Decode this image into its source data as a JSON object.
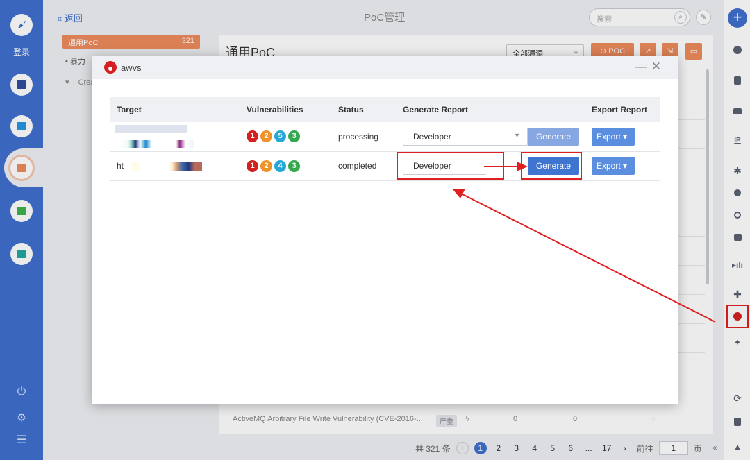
{
  "sidebar": {
    "login_label": "登录",
    "icon_colors": [
      "#2f4e9e",
      "#2596e0",
      "#ee8a5c",
      "#3fb34f",
      "#1fa8a0"
    ]
  },
  "header": {
    "back_label": "« 返回",
    "title": "PoC管理",
    "search_placeholder": "搜索"
  },
  "poc_list": {
    "active_item": {
      "label": "通用PoC",
      "count": "321"
    },
    "second_item_label": "暴力",
    "third_item_label": "Crea"
  },
  "main": {
    "title": "通用PoC",
    "filter_value": "全部漏洞",
    "poc_button_label": "POC",
    "last_row": {
      "name": "ActiveMQ Arbitrary File Write Vulnerability (CVE-2016-...",
      "severity": "严重",
      "count_a": "0",
      "count_b": "0"
    }
  },
  "pagination": {
    "total_label": "共 321 条",
    "pages": [
      "1",
      "2",
      "3",
      "4",
      "5",
      "6",
      "...",
      "17"
    ],
    "current_page": "1",
    "goto_prefix": "前往",
    "goto_value": "1",
    "goto_suffix": "页"
  },
  "modal": {
    "app_name": "awvs",
    "columns": [
      "Target",
      "Vulnerabilities",
      "Status",
      "Generate Report",
      "Export Report"
    ],
    "rows": [
      {
        "target_prefix": "",
        "vulns": [
          "1",
          "2",
          "5",
          "3"
        ],
        "status": "processing",
        "report_type": "Developer",
        "generate_label": "Generate",
        "export_label": "Export"
      },
      {
        "target_prefix": "ht",
        "vulns": [
          "1",
          "2",
          "4",
          "3"
        ],
        "status": "completed",
        "report_type": "Developer",
        "generate_label": "Generate",
        "export_label": "Export"
      }
    ]
  },
  "colors": {
    "severity": [
      "#d42020",
      "#f0922a",
      "#27a7d8",
      "#34a84c"
    ],
    "primary": "#3f6fcf",
    "accent_orange": "#ee8a5c",
    "annotation_red": "#e02020"
  },
  "icons": {
    "right_sidebar": [
      "plus-icon",
      "clock-icon",
      "doc-icon",
      "monitor-icon",
      "ip-icon",
      "bug-icon",
      "db-icon",
      "fingerprint-icon",
      "server-icon",
      "chart-icon",
      "puzzle-icon",
      "awvs-icon",
      "gear-cluster-icon",
      "refresh-icon",
      "report-icon",
      "warning-icon"
    ]
  }
}
